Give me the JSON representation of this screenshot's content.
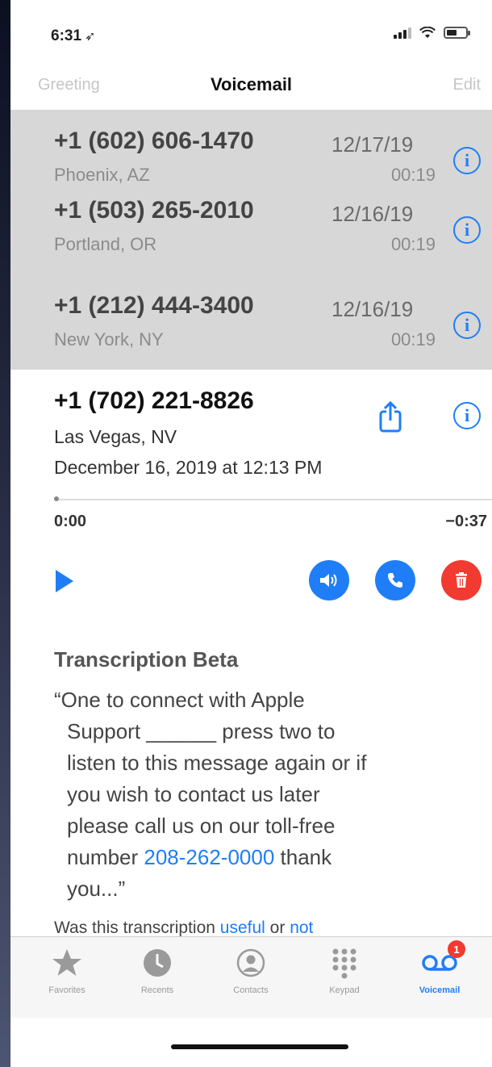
{
  "status_bar": {
    "time": "6:31",
    "location_glyph": "◄"
  },
  "nav": {
    "left": "Greeting",
    "title": "Voicemail",
    "right": "Edit"
  },
  "voicemails": [
    {
      "number": "+1 (602) 606-1470",
      "location": "Phoenix, AZ",
      "date": "12/17/19",
      "duration": "00:19"
    },
    {
      "number": "+1 (503) 265-2010",
      "location": "Portland, OR",
      "date": "12/16/19",
      "duration": "00:19"
    },
    {
      "number": "+1 (212) 444-3400",
      "location": "New York, NY",
      "date": "12/16/19",
      "duration": "00:19"
    }
  ],
  "detail": {
    "number": "+1 (702) 221-8826",
    "location": "Las Vegas, NV",
    "datetime": "December 16, 2019 at 12:13 PM",
    "elapsed": "0:00",
    "remaining": "−0:37",
    "progress": 0
  },
  "transcription": {
    "title": "Transcription Beta",
    "line1": "“One to connect with Apple",
    "line2": "Support ______ press two to",
    "line3": "listen to this message again or if",
    "line4": "you wish to contact us later",
    "line5": "please call us on our toll-free",
    "line6_pre": "number ",
    "phone": "208-262-0000",
    "line6_post": " thank",
    "line7": "you...”"
  },
  "feedback": {
    "prefix": "Was this transcription ",
    "useful": "useful",
    "middle": " or ",
    "not": "not"
  },
  "tabs": [
    {
      "label": "Favorites"
    },
    {
      "label": "Recents"
    },
    {
      "label": "Contacts"
    },
    {
      "label": "Keypad"
    },
    {
      "label": "Voicemail",
      "badge": "1"
    }
  ],
  "colors": {
    "accent": "#1f7ef7",
    "delete": "#f13a30",
    "list_background": "#d7d7d7"
  }
}
